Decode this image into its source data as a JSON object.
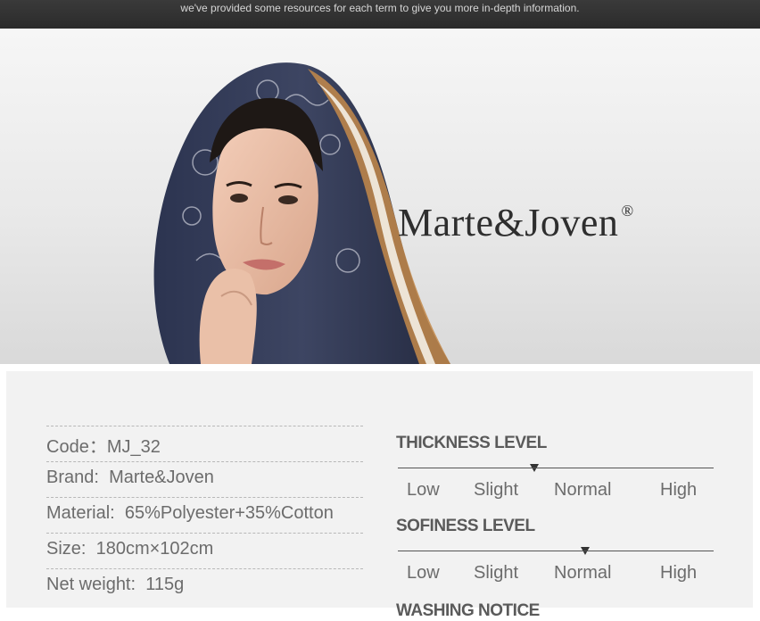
{
  "top_notice": "we've provided some resources for each term to give you more in-depth information.",
  "brand": {
    "name": "Marte&Joven",
    "registered": "®"
  },
  "specs": [
    {
      "label": "Code：",
      "value": "MJ_32"
    },
    {
      "label": "Brand:",
      "value": "Marte&Joven"
    },
    {
      "label": "Material:",
      "value": "65%Polyester+35%Cotton"
    },
    {
      "label": "Size:",
      "value": "180cm×102cm"
    },
    {
      "label": "Net weight:",
      "value": "115g"
    }
  ],
  "levels": {
    "thickness": {
      "title": "THICKNESS LEVEL",
      "selected": "Slight"
    },
    "softness": {
      "title": "SOFINESS LEVEL",
      "selected": "Normal"
    },
    "scale": [
      "Low",
      "Slight",
      "Normal",
      "High"
    ],
    "washing": {
      "title": "WASHING NOTICE"
    }
  }
}
